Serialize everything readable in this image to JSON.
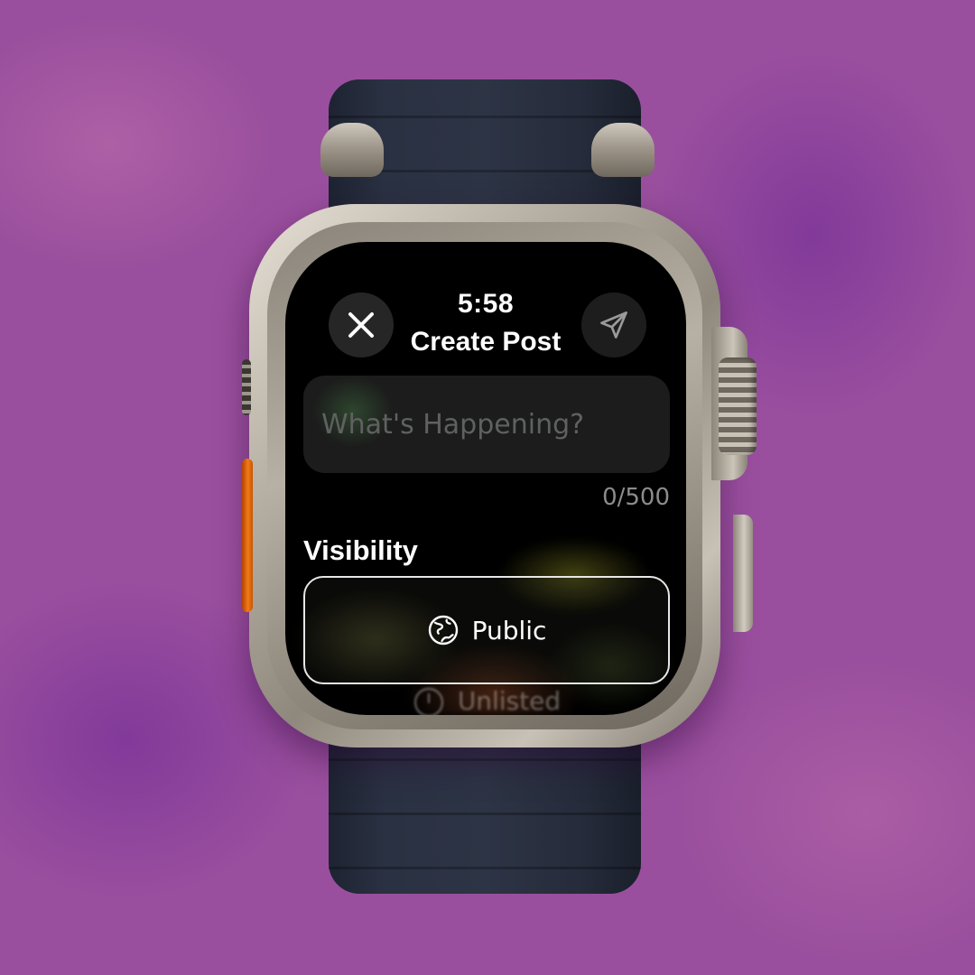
{
  "watch_screen": {
    "time": "5:58",
    "title": "Create Post",
    "close_icon": "close-icon",
    "send_icon": "paper-plane-icon",
    "post_input": {
      "placeholder": "What's Happening?",
      "value": ""
    },
    "char_count": "0/500",
    "visibility": {
      "label": "Visibility",
      "options": [
        {
          "label": "Public",
          "icon": "globe-icon",
          "selected": true
        },
        {
          "label": "Unlisted",
          "icon": "unlisted-icon",
          "selected": false
        }
      ]
    }
  },
  "colors": {
    "background": "#9a4f9e",
    "screen": "#000000",
    "input_bg": "#1b1c1b",
    "placeholder": "#5f6160",
    "side_button_accent": "#f27a1a"
  }
}
